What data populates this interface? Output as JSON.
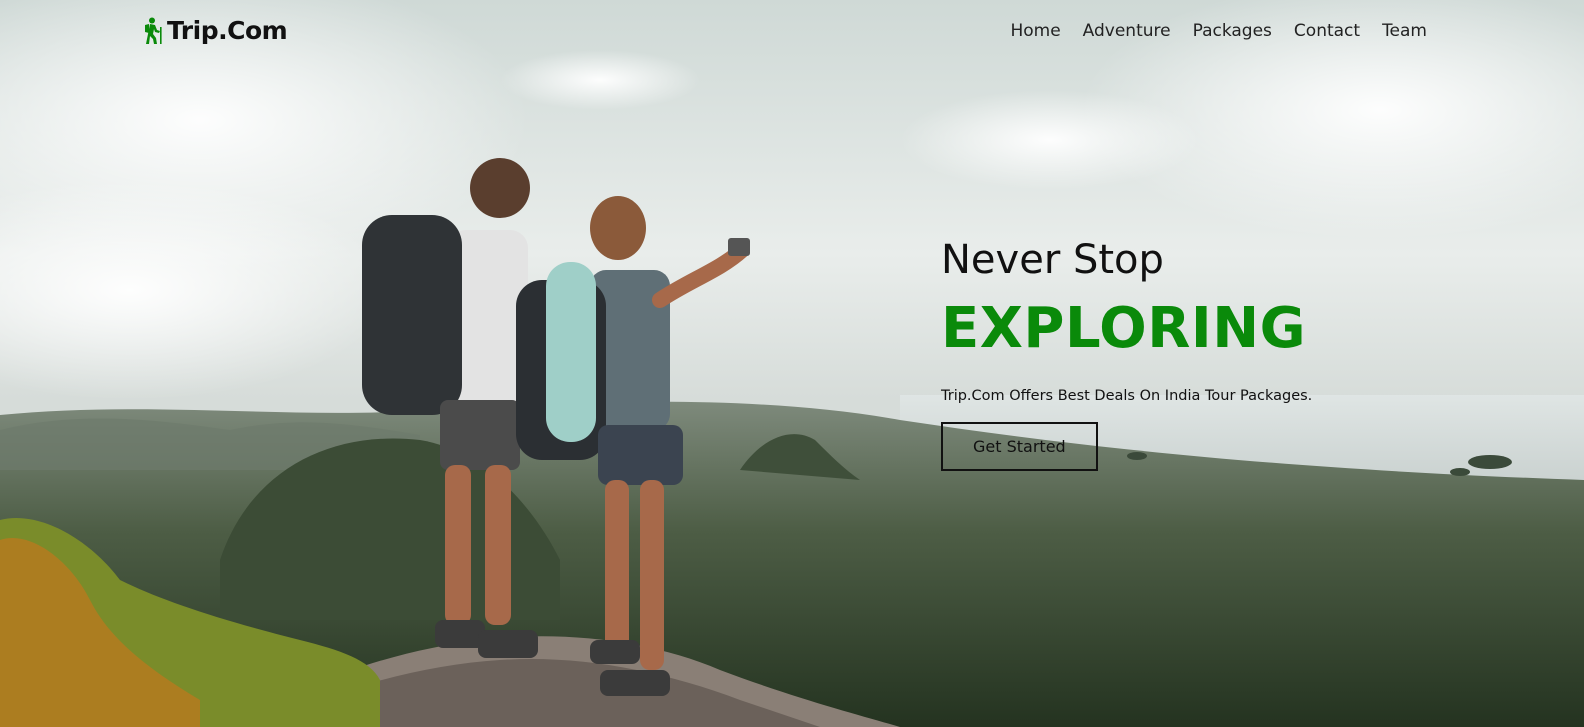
{
  "brand": {
    "name": "Trip.Com",
    "icon": "hiker-icon",
    "icon_color": "#0a8a0a"
  },
  "nav": {
    "items": [
      {
        "label": "Home"
      },
      {
        "label": "Adventure"
      },
      {
        "label": "Packages"
      },
      {
        "label": "Contact"
      },
      {
        "label": "Team"
      }
    ]
  },
  "hero": {
    "subtitle": "Never Stop",
    "title": "EXPLORING",
    "title_color": "#0a8a0a",
    "description": "Trip.Com Offers Best Deals On India Tour Packages.",
    "button_label": "Get Started"
  }
}
